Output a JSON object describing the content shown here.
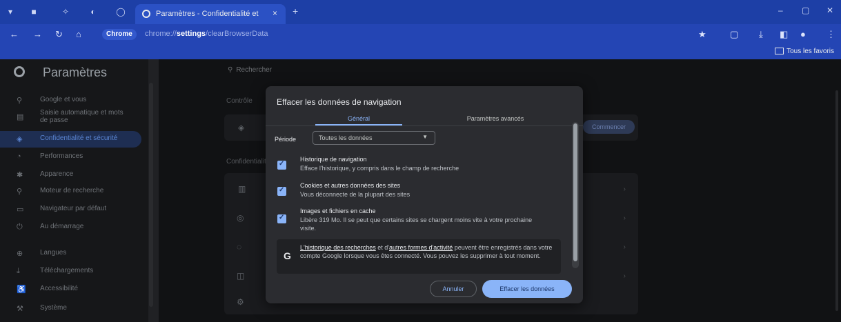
{
  "browser": {
    "tab_title": "Paramètres - Confidentialité et",
    "tab_close": "×",
    "new_tab": "+",
    "chip_label": "Chrome",
    "url_prefix": "chrome://",
    "url_bold": "settings",
    "url_suffix": "/clearBrowserData",
    "bookmarks_all": "Tous les favoris"
  },
  "sidebar": {
    "title": "Paramètres",
    "items": [
      {
        "icon": "person-icon",
        "glyph": "⚲",
        "label": "Google et vous"
      },
      {
        "icon": "clipboard-icon",
        "glyph": "▤",
        "label": "Saisie automatique et mots de passe"
      },
      {
        "icon": "shield-icon",
        "glyph": "◈",
        "label": "Confidentialité et sécurité"
      },
      {
        "icon": "performance-icon",
        "glyph": "◔",
        "label": "Performances"
      },
      {
        "icon": "palette-icon",
        "glyph": "✱",
        "label": "Apparence"
      },
      {
        "icon": "search-icon",
        "glyph": "⚲",
        "label": "Moteur de recherche"
      },
      {
        "icon": "browser-icon",
        "glyph": "▭",
        "label": "Navigateur par défaut"
      },
      {
        "icon": "power-icon",
        "glyph": "⏻",
        "label": "Au démarrage"
      },
      {
        "icon": "globe-icon",
        "glyph": "⊕",
        "label": "Langues"
      },
      {
        "icon": "download-icon",
        "glyph": "⤓",
        "label": "Téléchargements"
      },
      {
        "icon": "accessibility-icon",
        "glyph": "♿",
        "label": "Accessibilité"
      },
      {
        "icon": "wrench-icon",
        "glyph": "⚒",
        "label": "Système"
      }
    ]
  },
  "main": {
    "search_placeholder": "Rechercher",
    "section1_label": "Contrôle",
    "section2_label": "Confidentialité",
    "pill_label": "Commencer"
  },
  "dialog": {
    "title": "Effacer les données de navigation",
    "tab_basic": "Général",
    "tab_advanced": "Paramètres avancés",
    "period_label": "Période",
    "period_value": "Toutes les données",
    "options": [
      {
        "title": "Historique de navigation",
        "desc": "Efface l'historique, y compris dans le champ de recherche",
        "checked": true
      },
      {
        "title": "Cookies et autres données des sites",
        "desc": "Vous déconnecte de la plupart des sites",
        "checked": true
      },
      {
        "title": "Images et fichiers en cache",
        "desc": "Libère 319 Mo. Il se peut que certains sites se chargent moins vite à votre prochaine visite.",
        "checked": true
      }
    ],
    "info_link1": "L'historique des recherches",
    "info_mid": " et d'",
    "info_link2": "autres formes d'activité",
    "info_rest": " peuvent être enregistrés dans votre compte Google lorsque vous êtes connecté. Vous pouvez les supprimer à tout moment.",
    "cancel_label": "Annuler",
    "clear_label": "Effacer les données"
  },
  "colors": {
    "browser_frame": "#2445b4",
    "accent": "#8ab4f8",
    "dialog_bg": "#2b2c30"
  }
}
